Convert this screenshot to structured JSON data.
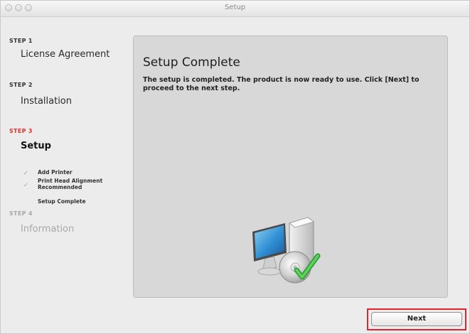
{
  "window": {
    "title": "Setup"
  },
  "steps": [
    {
      "number": "STEP 1",
      "name": "License Agreement",
      "state": "done"
    },
    {
      "number": "STEP 2",
      "name": "Installation",
      "state": "done"
    },
    {
      "number": "STEP 3",
      "name": "Setup",
      "state": "active"
    },
    {
      "number": "STEP 4",
      "name": "Information",
      "state": "pending"
    }
  ],
  "substeps": [
    {
      "label": "Add Printer",
      "checked": true
    },
    {
      "label": "Print Head Alignment Recommended",
      "checked": true
    },
    {
      "label": "Setup Complete",
      "checked": false
    }
  ],
  "content": {
    "heading": "Setup Complete",
    "body": "The setup is completed. The product is now ready to use. Click [Next] to proceed to the next step.",
    "illustration_icon": "computer-install-complete-icon"
  },
  "footer": {
    "next_label": "Next"
  },
  "colors": {
    "active_step": "#e0352b",
    "inactive_step": "#a8a8a8",
    "highlight": "#e0222a",
    "check_green": "#3cb43c"
  }
}
